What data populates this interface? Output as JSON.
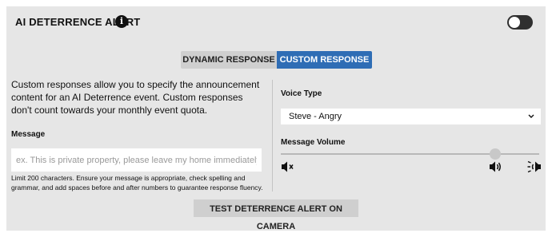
{
  "header": {
    "title": "AI DETERRENCE ALERT",
    "info_icon": "info-icon",
    "info_glyph": "i",
    "toggle_on": false
  },
  "tabs": [
    {
      "label": "DYNAMIC RESPONSE",
      "selected": false
    },
    {
      "label": "CUSTOM RESPONSE",
      "selected": true
    }
  ],
  "colors": {
    "accent": "#2f6db5",
    "panel_bg": "#e6e6e6"
  },
  "description": "Custom responses allow you to specify the announcement content for an AI Deterrence event. Custom responses don't count towards your monthly event quota.",
  "message": {
    "label": "Message",
    "value": "",
    "placeholder": "ex. This is private property, please leave my home immediately!",
    "hint": "Limit 200 characters. Ensure your message is appropriate, check spelling and grammar, and add spaces before and after numbers to guarantee response fluency."
  },
  "voice": {
    "label": "Voice Type",
    "selected": "Steve - Angry",
    "chevron_icon": "chevron-down-icon"
  },
  "volume": {
    "label": "Message Volume",
    "level": 0.83,
    "icons": [
      "mute-icon",
      "volume-icon",
      "volume-max-icon"
    ]
  },
  "actions": {
    "test_label": "TEST DETERRENCE ALERT ON CAMERA"
  }
}
